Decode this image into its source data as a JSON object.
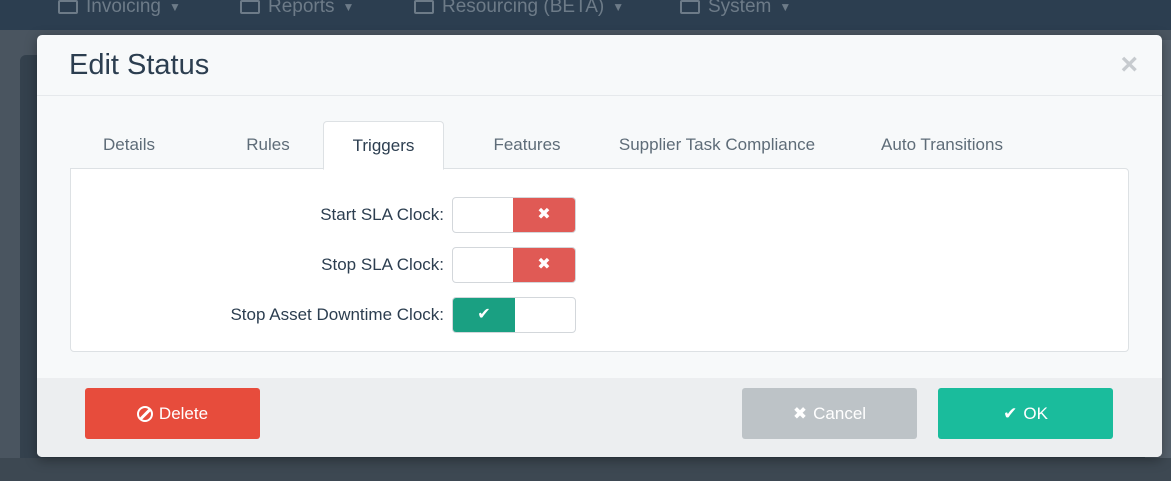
{
  "background": {
    "nav": [
      {
        "label": "Invoicing",
        "icon": "invoice-icon"
      },
      {
        "label": "Reports",
        "icon": "chart-icon"
      },
      {
        "label": "Resourcing (BETA)",
        "icon": "wrench-icon"
      },
      {
        "label": "System",
        "icon": "monitor-icon"
      }
    ]
  },
  "modal": {
    "title": "Edit Status",
    "close_label": "×",
    "tabs": [
      {
        "label": "Details"
      },
      {
        "label": "Rules"
      },
      {
        "label": "Triggers"
      },
      {
        "label": "Features"
      },
      {
        "label": "Supplier Task Compliance"
      },
      {
        "label": "Auto Transitions"
      }
    ],
    "active_tab": "Triggers",
    "triggers": [
      {
        "label": "Start SLA Clock:",
        "enabled": false,
        "glyph": "✖"
      },
      {
        "label": "Stop SLA Clock:",
        "enabled": false,
        "glyph": "✖"
      },
      {
        "label": "Stop Asset Downtime Clock:",
        "enabled": true,
        "glyph": "✔"
      }
    ],
    "footer": {
      "delete_label": "Delete",
      "cancel_label": "Cancel",
      "cancel_glyph": "✖",
      "ok_label": "OK",
      "ok_glyph": "✔"
    }
  },
  "colors": {
    "danger": "#e74c3c",
    "toggle_off": "#e05a55",
    "toggle_on": "#1aa082",
    "ok": "#1abc9c",
    "cancel": "#bdc3c7",
    "title_text": "#2c3e50"
  }
}
